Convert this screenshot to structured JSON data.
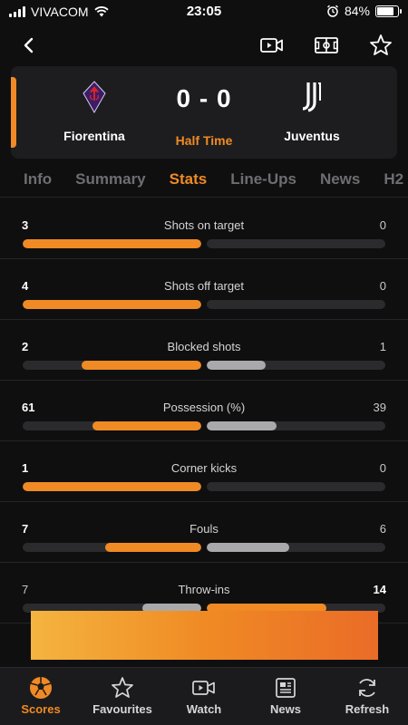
{
  "status_bar": {
    "carrier": "VIVACOM",
    "time": "23:05",
    "battery": "84%"
  },
  "topnav": {
    "icons": [
      "back-chevron-icon",
      "video-icon",
      "pitch-icon",
      "star-icon"
    ]
  },
  "match": {
    "home_team": "Fiorentina",
    "away_team": "Juventus",
    "score": "0 - 0",
    "status": "Half Time"
  },
  "tabs": [
    "Info",
    "Summary",
    "Stats",
    "Line-Ups",
    "News",
    "H2"
  ],
  "active_tab": "Stats",
  "stats": [
    {
      "label": "Shots on target",
      "home": "3",
      "away": "0",
      "home_frac": 1.0,
      "away_frac": 0.0,
      "home_color": "orange",
      "away_color": "grey",
      "bold": "home"
    },
    {
      "label": "Shots off target",
      "home": "4",
      "away": "0",
      "home_frac": 1.0,
      "away_frac": 0.0,
      "home_color": "orange",
      "away_color": "grey",
      "bold": "home"
    },
    {
      "label": "Blocked shots",
      "home": "2",
      "away": "1",
      "home_frac": 0.67,
      "away_frac": 0.33,
      "home_color": "orange",
      "away_color": "grey",
      "bold": "home"
    },
    {
      "label": "Possession (%)",
      "home": "61",
      "away": "39",
      "home_frac": 0.61,
      "away_frac": 0.39,
      "home_color": "orange",
      "away_color": "grey",
      "bold": "home"
    },
    {
      "label": "Corner kicks",
      "home": "1",
      "away": "0",
      "home_frac": 1.0,
      "away_frac": 0.0,
      "home_color": "orange",
      "away_color": "grey",
      "bold": "home"
    },
    {
      "label": "Fouls",
      "home": "7",
      "away": "6",
      "home_frac": 0.54,
      "away_frac": 0.46,
      "home_color": "orange",
      "away_color": "grey",
      "bold": "home"
    },
    {
      "label": "Throw-ins",
      "home": "7",
      "away": "14",
      "home_frac": 0.33,
      "away_frac": 0.67,
      "home_color": "grey",
      "away_color": "orange",
      "bold": "away"
    }
  ],
  "bottom_nav": [
    {
      "label": "Scores",
      "icon": "soccer-ball-icon",
      "active": true
    },
    {
      "label": "Favourites",
      "icon": "star-outline-icon",
      "active": false
    },
    {
      "label": "Watch",
      "icon": "video-icon",
      "active": false
    },
    {
      "label": "News",
      "icon": "newspaper-icon",
      "active": false
    },
    {
      "label": "Refresh",
      "icon": "refresh-icon",
      "active": false
    }
  ],
  "colors": {
    "accent": "#f08a24",
    "bar_track": "#2b2b2e",
    "bar_grey": "#a9a9ac",
    "background": "#0f0f10"
  }
}
